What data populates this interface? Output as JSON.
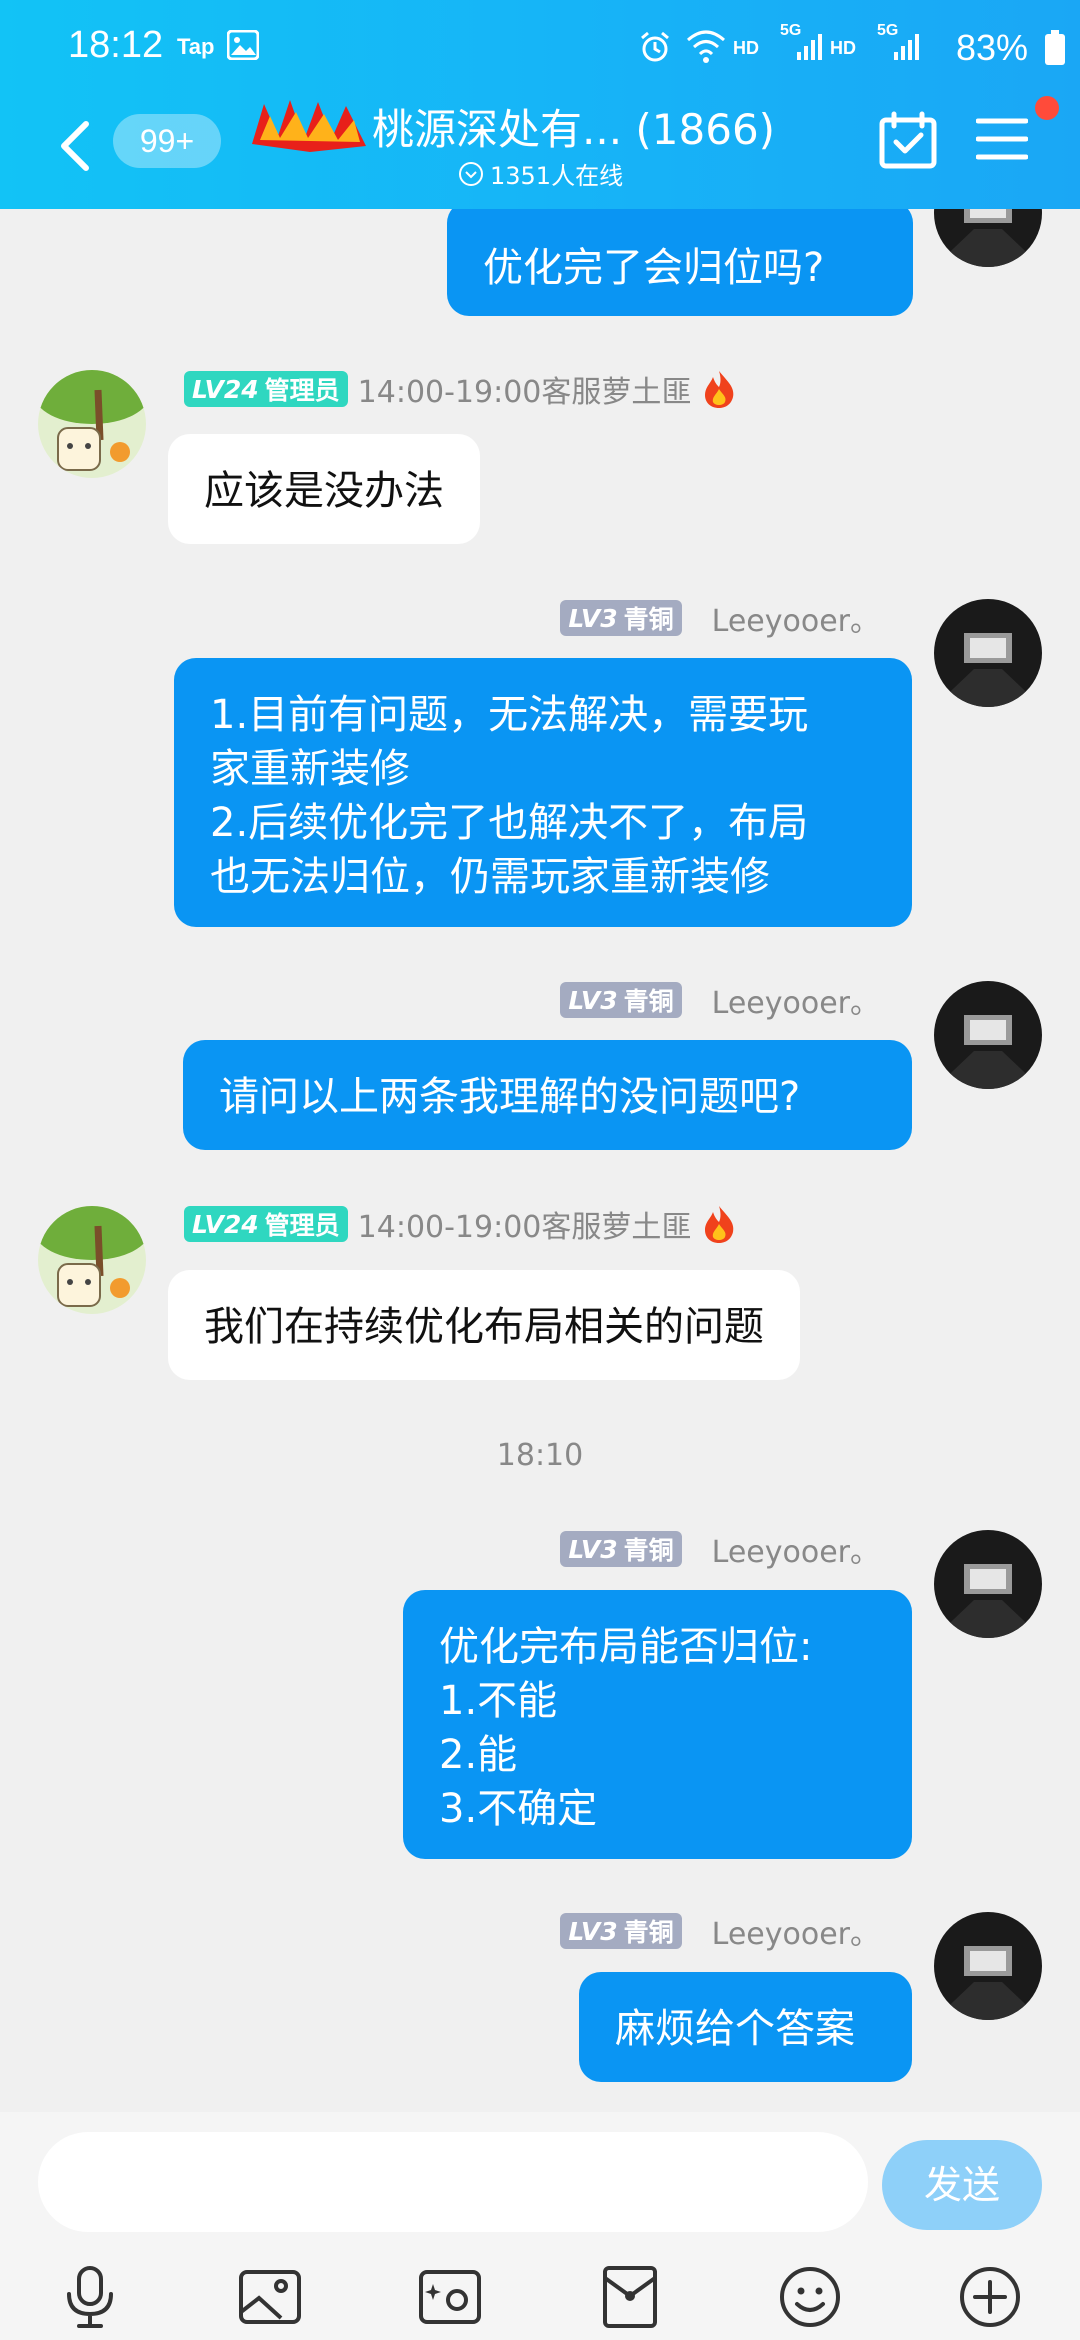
{
  "status_bar": {
    "time": "18:12",
    "app_tag": "Tap",
    "hd1": "HD",
    "hd2": "HD",
    "net1": "5G",
    "net2": "5G",
    "battery": "83%"
  },
  "header": {
    "unread_badge": "99+",
    "group_title": "桃源深处有... (1866)",
    "online_count": "1351人在线"
  },
  "colors": {
    "header": "#17b2f7",
    "self_bubble": "#0a95f3",
    "admin_badge": "#2fd7c0",
    "bronze_badge": "#a4abc1",
    "send_button": "#8ed0f9"
  },
  "messages": [
    {
      "text": "优化完了会归位吗?"
    },
    {
      "level": "LV24",
      "role": "管理员",
      "sender": "14:00-19:00客服萝土匪",
      "text": "应该是没办法"
    },
    {
      "level": "LV3",
      "role": "青铜",
      "sender": "Leeyooer。",
      "text": "1.目前有问题，无法解决，需要玩\n家重新装修\n2.后续优化完了也解决不了，布局\n也无法归位，仍需玩家重新装修"
    },
    {
      "level": "LV3",
      "role": "青铜",
      "sender": "Leeyooer。",
      "text": "请问以上两条我理解的没问题吧?"
    },
    {
      "level": "LV24",
      "role": "管理员",
      "sender": "14:00-19:00客服萝土匪",
      "text": "我们在持续优化布局相关的问题"
    },
    {
      "level": "LV3",
      "role": "青铜",
      "sender": "Leeyooer。",
      "text": "优化完布局能否归位:\n1.不能\n2.能\n3.不确定"
    },
    {
      "level": "LV3",
      "role": "青铜",
      "sender": "Leeyooer。",
      "text": "麻烦给个答案"
    }
  ],
  "timestamp": "18:10",
  "input": {
    "placeholder": "",
    "send_label": "发送"
  },
  "toolbar": [
    "microphone-icon",
    "image-icon",
    "camera-icon",
    "red-packet-icon",
    "emoji-icon",
    "plus-icon"
  ]
}
